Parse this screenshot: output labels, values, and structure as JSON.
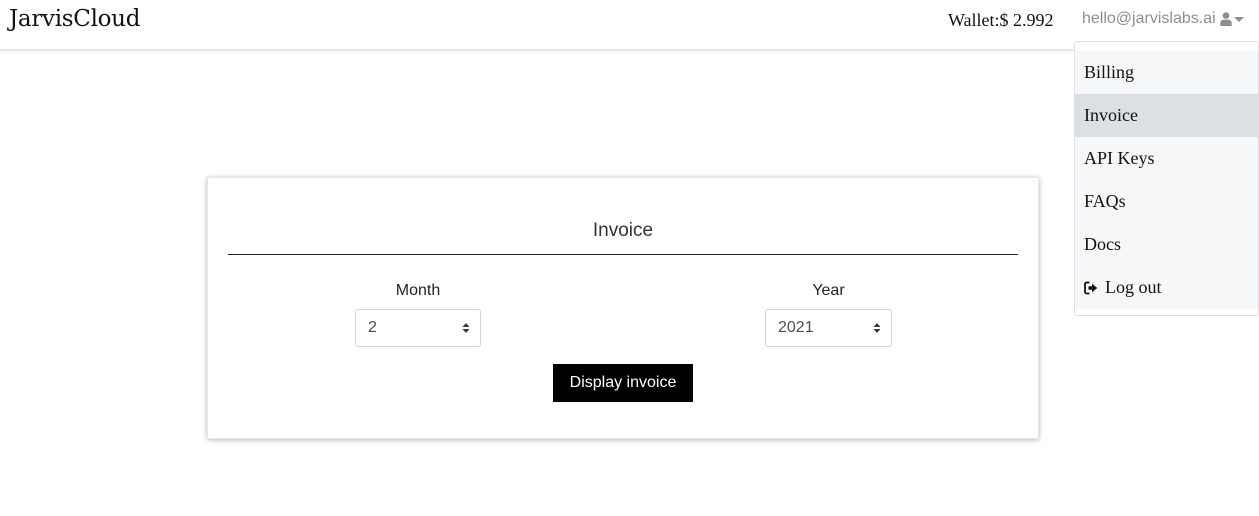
{
  "navbar": {
    "brand": "JarvisCloud",
    "wallet": "Wallet:$ 2.992",
    "user_email": "hello@jarvislabs.ai",
    "user_icon": "user-icon",
    "caret_icon": "caret-down-icon"
  },
  "dropdown": {
    "items": [
      {
        "label": "Billing",
        "active": false
      },
      {
        "label": "Invoice",
        "active": true
      },
      {
        "label": "API Keys",
        "active": false
      },
      {
        "label": "FAQs",
        "active": false
      },
      {
        "label": "Docs",
        "active": false
      },
      {
        "label": "Log out",
        "active": false,
        "icon": "sign-out-icon"
      }
    ]
  },
  "invoice": {
    "title": "Invoice",
    "month_label": "Month",
    "month_value": "2",
    "year_label": "Year",
    "year_value": "2021",
    "display_button": "Display invoice"
  },
  "colors": {
    "active_menu_bg": "#dcdfe4",
    "menu_bg": "#f6f7f9",
    "button_bg": "#000000",
    "muted_text": "#8a8f94"
  }
}
